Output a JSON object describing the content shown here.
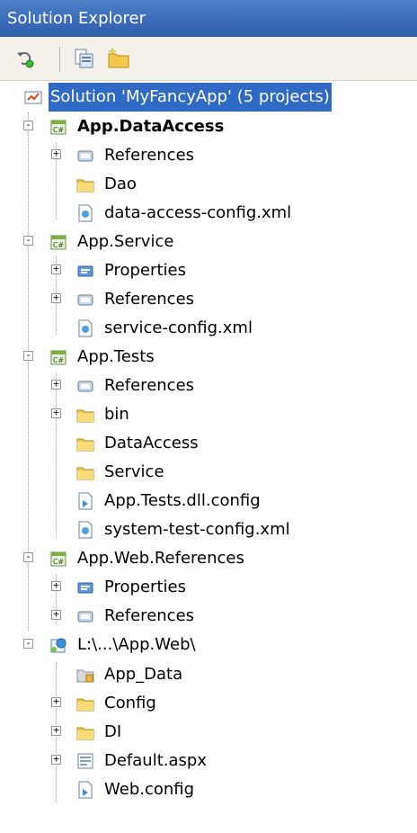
{
  "window": {
    "title": "Solution Explorer"
  },
  "toolbar": {
    "buttons": [
      {
        "name": "refresh-icon"
      },
      {
        "name": "show-all-files-icon"
      },
      {
        "name": "new-folder-icon"
      }
    ]
  },
  "tree": {
    "solution": "Solution 'MyFancyApp' (5 projects)",
    "data_access": {
      "label": "App.DataAccess",
      "references": "References",
      "dao": "Dao",
      "config": "data-access-config.xml"
    },
    "service": {
      "label": "App.Service",
      "properties": "Properties",
      "references": "References",
      "config": "service-config.xml"
    },
    "tests": {
      "label": "App.Tests",
      "references": "References",
      "bin": "bin",
      "data_access": "DataAccess",
      "service": "Service",
      "dll_config": "App.Tests.dll.config",
      "system_test": "system-test-config.xml"
    },
    "web_references": {
      "label": "App.Web.References",
      "properties": "Properties",
      "references": "References"
    },
    "web": {
      "label": "L:\\...\\App.Web\\",
      "app_data": "App_Data",
      "config": "Config",
      "di": "DI",
      "default": "Default.aspx",
      "web_config": "Web.config"
    }
  },
  "colors": {
    "selection": "#316ac5",
    "title": "#3a6ab8",
    "folder": "#f2c94c"
  }
}
